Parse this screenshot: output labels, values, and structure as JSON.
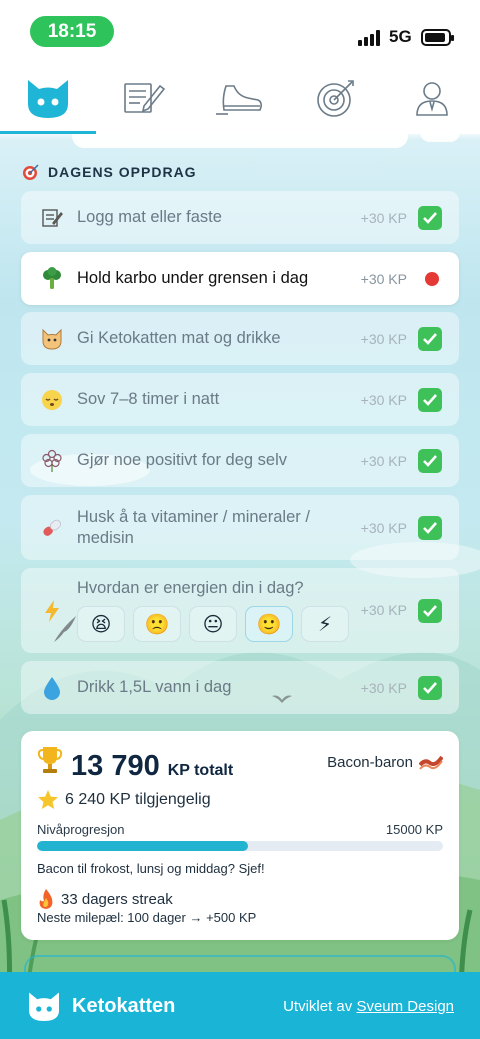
{
  "status_bar": {
    "time": "18:15",
    "network": "5G"
  },
  "nav": {
    "tabs": [
      {
        "name": "cat-icon",
        "active": true
      },
      {
        "name": "notes-icon",
        "active": false
      },
      {
        "name": "sneaker-icon",
        "active": false
      },
      {
        "name": "target-icon",
        "active": false
      },
      {
        "name": "profile-icon",
        "active": false
      }
    ]
  },
  "missions": {
    "title": "DAGENS OPPDRAG",
    "items": [
      {
        "label": "Logg mat eller faste",
        "reward": "+30 KP",
        "done": true,
        "icon": "notepad-icon"
      },
      {
        "label": "Hold karbo under grensen i dag",
        "reward": "+30 KP",
        "done": false,
        "icon": "broccoli-icon"
      },
      {
        "label": "Gi Ketokatten mat og drikke",
        "reward": "+30 KP",
        "done": true,
        "icon": "cat-face-icon"
      },
      {
        "label": "Sov 7–8 timer i natt",
        "reward": "+30 KP",
        "done": true,
        "icon": "sleeping-face-icon"
      },
      {
        "label": "Gjør noe positivt for deg selv",
        "reward": "+30 KP",
        "done": true,
        "icon": "flower-icon"
      },
      {
        "label": "Husk å ta vitaminer / mineraler / medisin",
        "reward": "+30 KP",
        "done": true,
        "icon": "pill-icon"
      },
      {
        "label": "Hvordan er energien din i dag?",
        "reward": "+30 KP",
        "done": true,
        "icon": "lightning-icon",
        "moods": [
          "😫",
          "🙁",
          "😐",
          "🙂",
          "⚡"
        ],
        "selected_mood": 3
      },
      {
        "label": "Drikk 1,5L vann i dag",
        "reward": "+30 KP",
        "done": true,
        "icon": "droplet-icon"
      }
    ]
  },
  "stats": {
    "total": "13 790",
    "total_unit": "KP totalt",
    "rank": "Bacon-baron",
    "available": "6 240 KP tilgjengelig",
    "level_label": "Nivåprogresjon",
    "level_max": "15000 KP",
    "level_progress": 0.52,
    "quote": "Bacon til frokost, lunsj og middag? Sjef!",
    "streak": "33 dagers streak",
    "milestone": "Neste milepæl: 100 dager → +500 KP"
  },
  "footer": {
    "brand": "Ketokatten",
    "credit_prefix": "Utviklet av",
    "credit_link": "Sveum Design"
  },
  "colors": {
    "accent": "#1ab4d6",
    "done": "#3fc15a",
    "pending": "#e53935",
    "status_green": "#2ec35b"
  }
}
